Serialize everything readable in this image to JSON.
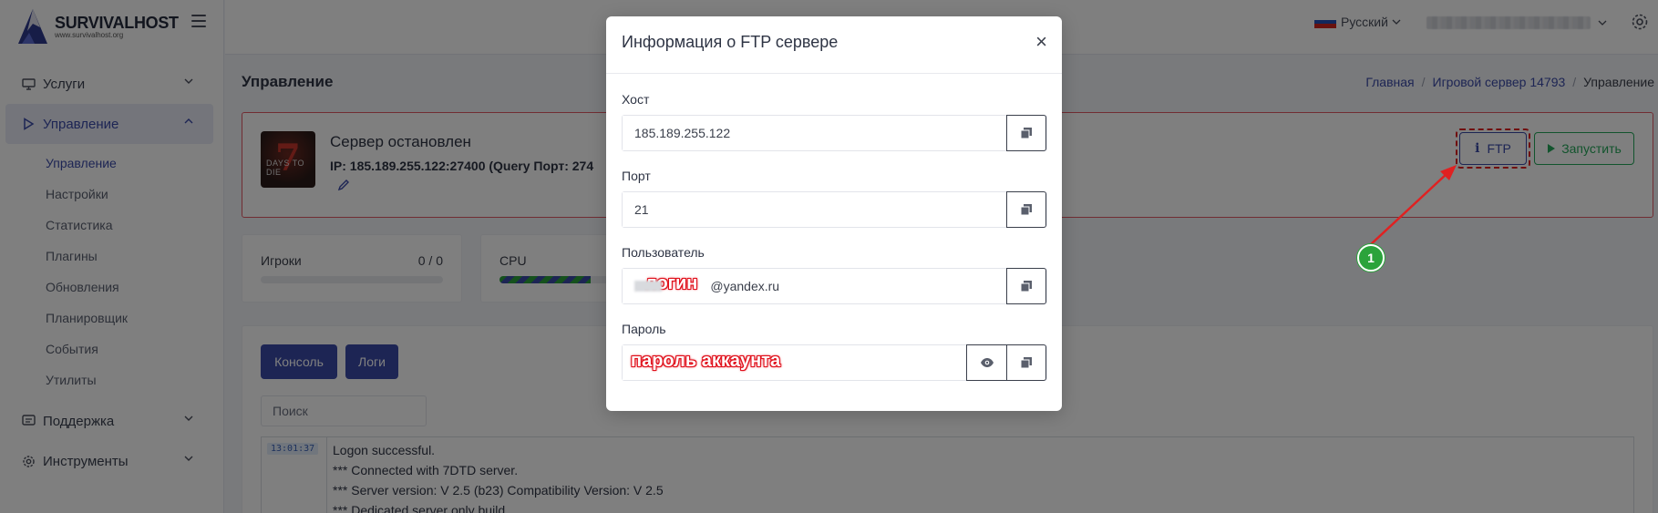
{
  "brand": {
    "name": "SURVIVALHOST",
    "url": "www.survivalhost.org"
  },
  "sidebar": {
    "items": [
      {
        "label": "Услуги",
        "icon": "monitor-icon"
      },
      {
        "label": "Управление",
        "icon": "play-icon",
        "children": [
          "Управление",
          "Настройки",
          "Статистика",
          "Плагины",
          "Обновления",
          "Планировщик",
          "События",
          "Утилиты"
        ]
      },
      {
        "label": "Поддержка",
        "icon": "support-icon"
      },
      {
        "label": "Инструменты",
        "icon": "gear-icon"
      }
    ]
  },
  "topbar": {
    "language": "Русский"
  },
  "page": {
    "title": "Управление",
    "breadcrumb": [
      "Главная",
      "Игровой сервер 14793",
      "Управление"
    ]
  },
  "server": {
    "logo_text": "7",
    "logo_sub": "DAYS TO DIE",
    "status": "Сервер остановлен",
    "ip_label": "IP:",
    "ip_value": "185.189.255.122:27400 (Query Порт: 274",
    "ftp_label": "FTP",
    "start_label": "Запустить"
  },
  "stats": {
    "players": {
      "label": "Игроки",
      "value": "0 / 0",
      "fill": 0
    },
    "cpu": {
      "label": "CPU",
      "fill": 0.5
    }
  },
  "console": {
    "tab_console": "Консоль",
    "tab_logs": "Логи",
    "search_placeholder": "Поиск",
    "time": "13:01:37",
    "lines": [
      "Logon successful.",
      "*** Connected with 7DTD server.",
      "*** Server version: V 2.5 (b23) Compatibility Version: V 2.5",
      "*** Dedicated server only build"
    ]
  },
  "modal": {
    "title": "Информация о FTP сервере",
    "close": "×",
    "host_label": "Хост",
    "host_value": "185.189.255.122",
    "port_label": "Порт",
    "port_value": "21",
    "user_label": "Пользователь",
    "user_annotation": "логин",
    "user_suffix": "@yandex.ru",
    "password_label": "Пароль",
    "password_annotation": "пароль аккаунта"
  },
  "annotation": {
    "marker": "1"
  },
  "colors": {
    "accent": "#3b4aa8",
    "danger": "#e35b67",
    "success": "#25a85a",
    "annotation_red": "#e02121",
    "marker_green": "#2ba33b"
  }
}
